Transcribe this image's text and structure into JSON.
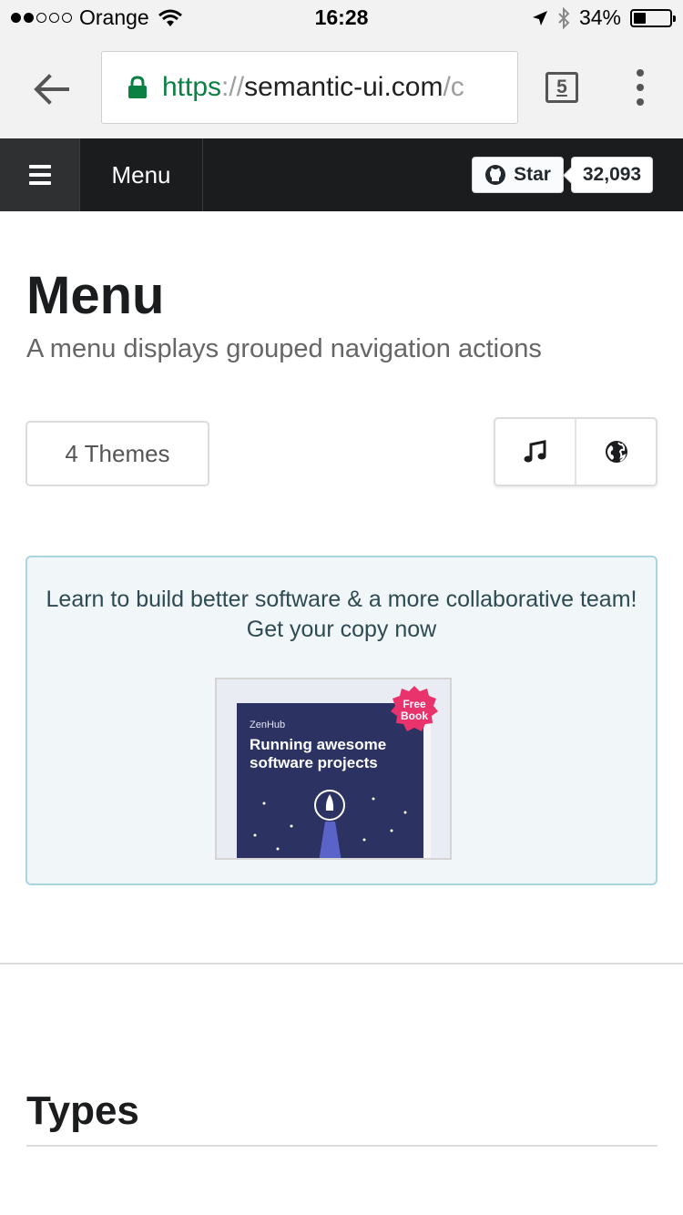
{
  "status_bar": {
    "carrier": "Orange",
    "time": "16:28",
    "battery": "34%",
    "battery_level": 0.34,
    "signal_bars_filled": 2,
    "signal_bars_total": 5
  },
  "browser": {
    "url_scheme": "https",
    "url_separator": "://",
    "url_host": "semantic-ui.com",
    "url_rest": "/c",
    "tab_count": "5",
    "secure_color": "#0b8043"
  },
  "site_header": {
    "title": "Menu",
    "github_star_label": "Star",
    "github_star_count": "32,093",
    "background": "#1b1c1d"
  },
  "page": {
    "title": "Menu",
    "subtitle": "A menu displays grouped navigation actions",
    "themes_button": "4 Themes",
    "icon_buttons": [
      "music-icon",
      "globe-icon"
    ]
  },
  "ad": {
    "text": "Learn to build better software & a more collaborative team! Get your copy now",
    "book_brand": "ZenHub",
    "book_title": "Running awesome software projects",
    "badge_text": "Free Book",
    "accent": "#e8336d"
  },
  "section": {
    "title": "Types"
  }
}
